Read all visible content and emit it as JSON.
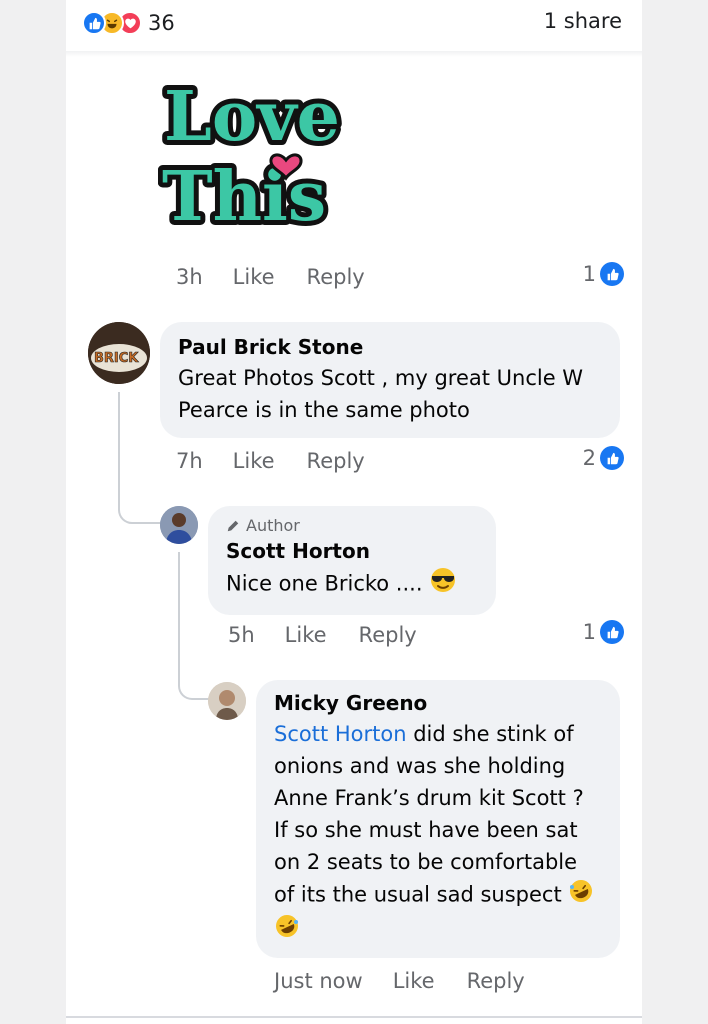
{
  "post": {
    "reaction_count": "36",
    "share_count": "1 share",
    "reaction_icons": [
      "like-icon",
      "haha-icon",
      "love-icon"
    ]
  },
  "sticker_comment": {
    "sticker_text_line1": "Love",
    "sticker_text_line2": "This",
    "time": "3h",
    "like_label": "Like",
    "reply_label": "Reply",
    "like_count": "1"
  },
  "comments": [
    {
      "name": "Paul Brick Stone",
      "text": "Great Photos Scott , my great Uncle W Pearce is in the same photo",
      "time": "7h",
      "like_label": "Like",
      "reply_label": "Reply",
      "like_count": "2"
    },
    {
      "badge": "Author",
      "name": "Scott Horton",
      "text": "Nice one Bricko ....",
      "time": "5h",
      "like_label": "Like",
      "reply_label": "Reply",
      "like_count": "1"
    },
    {
      "name": "Micky Greeno",
      "mention": "Scott Horton",
      "text": " did she stink of onions and was she holding Anne Frank’s drum kit Scott ? If so she must have been sat on 2 seats to be comfortable of its the usual sad suspect",
      "time": "Just now",
      "like_label": "Like",
      "reply_label": "Reply"
    }
  ],
  "colors": {
    "accent": "#1877f2",
    "mention": "#1a6ed8",
    "bubble": "#f0f2f5",
    "sticker_fill": "#3cc7a5"
  }
}
